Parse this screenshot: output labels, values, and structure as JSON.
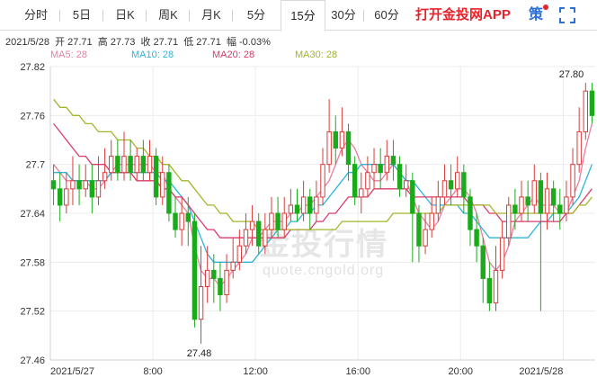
{
  "tabs": [
    {
      "id": "timeshare",
      "label": "分时"
    },
    {
      "id": "5day",
      "label": "5日"
    },
    {
      "id": "daily",
      "label": "日K"
    },
    {
      "id": "weekly",
      "label": "周K"
    },
    {
      "id": "monthly",
      "label": "月K"
    },
    {
      "id": "5min",
      "label": "5分"
    },
    {
      "id": "15min",
      "label": "15分"
    },
    {
      "id": "30min",
      "label": "30分"
    },
    {
      "id": "60min",
      "label": "60分"
    }
  ],
  "active_tab": "15min",
  "promo_text": "打开金投网APP",
  "strategy_label": "策",
  "more_label": "",
  "info_bar": {
    "date": "2021/5/28",
    "open_label": "开",
    "open": "27.71",
    "high_label": "高",
    "high": "27.73",
    "close_label": "收",
    "close": "27.71",
    "low_label": "低",
    "low": "27.71",
    "amp_label": "幅",
    "amp": "-0.03%"
  },
  "legend": [
    {
      "label": "MA5: 28",
      "color": "#e87fa0"
    },
    {
      "label": "MA10: 28",
      "color": "#2bb5d8"
    },
    {
      "label": "MA20: 28",
      "color": "#d93b6a"
    },
    {
      "label": "MA30: 28",
      "color": "#a3b52a"
    }
  ],
  "watermark": {
    "main": "金投行情",
    "sub": "quote.cngold.org"
  },
  "chart_data": {
    "type": "candlestick",
    "interval": "15分",
    "ylim": [
      27.46,
      27.82
    ],
    "y_ticks": [
      "27.82",
      "27.76",
      "27.7",
      "27.64",
      "27.58",
      "27.52",
      "27.46"
    ],
    "y_tick_values": [
      27.82,
      27.76,
      27.7,
      27.64,
      27.58,
      27.52,
      27.46
    ],
    "x_ticks": [
      "2021/5/27",
      "8:00",
      "12:00",
      "16:00",
      "20:00",
      "2021/5/28"
    ],
    "x_tick_index": [
      0,
      16,
      32,
      48,
      64,
      80
    ],
    "annotations": [
      {
        "label": "27.80",
        "index": 83,
        "value": 27.8
      },
      {
        "label": "27.48",
        "index": 23,
        "value": 27.48
      }
    ],
    "up_color": "#d93b3b",
    "down_color": "#1aab1a",
    "candles": [
      [
        27.68,
        27.67,
        27.7,
        27.65
      ],
      [
        27.67,
        27.65,
        27.69,
        27.63
      ],
      [
        27.65,
        27.67,
        27.69,
        27.64
      ],
      [
        27.67,
        27.68,
        27.71,
        27.65
      ],
      [
        27.68,
        27.67,
        27.7,
        27.65
      ],
      [
        27.67,
        27.68,
        27.7,
        27.66
      ],
      [
        27.68,
        27.66,
        27.7,
        27.64
      ],
      [
        27.66,
        27.68,
        27.71,
        27.65
      ],
      [
        27.68,
        27.69,
        27.72,
        27.67
      ],
      [
        27.69,
        27.71,
        27.73,
        27.68
      ],
      [
        27.71,
        27.69,
        27.73,
        27.68
      ],
      [
        27.69,
        27.71,
        27.74,
        27.68
      ],
      [
        27.71,
        27.69,
        27.73,
        27.68
      ],
      [
        27.69,
        27.71,
        27.72,
        27.68
      ],
      [
        27.71,
        27.69,
        27.73,
        27.68
      ],
      [
        27.69,
        27.71,
        27.73,
        27.68
      ],
      [
        27.71,
        27.66,
        27.72,
        27.65
      ],
      [
        27.66,
        27.69,
        27.71,
        27.65
      ],
      [
        27.69,
        27.64,
        27.7,
        27.63
      ],
      [
        27.64,
        27.62,
        27.66,
        27.61
      ],
      [
        27.62,
        27.64,
        27.66,
        27.6
      ],
      [
        27.64,
        27.63,
        27.66,
        27.6
      ],
      [
        27.63,
        27.51,
        27.64,
        27.5
      ],
      [
        27.51,
        27.55,
        27.6,
        27.48
      ],
      [
        27.55,
        27.57,
        27.6,
        27.53
      ],
      [
        27.57,
        27.56,
        27.59,
        27.53
      ],
      [
        27.56,
        27.54,
        27.58,
        27.52
      ],
      [
        27.54,
        27.57,
        27.59,
        27.53
      ],
      [
        27.57,
        27.58,
        27.61,
        27.56
      ],
      [
        27.58,
        27.6,
        27.62,
        27.57
      ],
      [
        27.6,
        27.62,
        27.64,
        27.59
      ],
      [
        27.62,
        27.63,
        27.65,
        27.6
      ],
      [
        27.63,
        27.6,
        27.64,
        27.59
      ],
      [
        27.6,
        27.62,
        27.64,
        27.59
      ],
      [
        27.62,
        27.64,
        27.66,
        27.61
      ],
      [
        27.64,
        27.62,
        27.66,
        27.61
      ],
      [
        27.62,
        27.64,
        27.66,
        27.61
      ],
      [
        27.64,
        27.65,
        27.67,
        27.63
      ],
      [
        27.65,
        27.64,
        27.67,
        27.63
      ],
      [
        27.64,
        27.66,
        27.68,
        27.63
      ],
      [
        27.66,
        27.64,
        27.67,
        27.62
      ],
      [
        27.64,
        27.66,
        27.68,
        27.63
      ],
      [
        27.66,
        27.7,
        27.72,
        27.65
      ],
      [
        27.7,
        27.74,
        27.78,
        27.69
      ],
      [
        27.74,
        27.72,
        27.76,
        27.7
      ],
      [
        27.72,
        27.74,
        27.77,
        27.71
      ],
      [
        27.74,
        27.7,
        27.75,
        27.68
      ],
      [
        27.7,
        27.66,
        27.71,
        27.65
      ],
      [
        27.66,
        27.67,
        27.69,
        27.64
      ],
      [
        27.67,
        27.69,
        27.71,
        27.66
      ],
      [
        27.69,
        27.7,
        27.72,
        27.67
      ],
      [
        27.7,
        27.69,
        27.72,
        27.67
      ],
      [
        27.69,
        27.71,
        27.73,
        27.68
      ],
      [
        27.71,
        27.7,
        27.73,
        27.68
      ],
      [
        27.7,
        27.67,
        27.71,
        27.66
      ],
      [
        27.67,
        27.68,
        27.7,
        27.66
      ],
      [
        27.68,
        27.64,
        27.69,
        27.58
      ],
      [
        27.64,
        27.6,
        27.65,
        27.58
      ],
      [
        27.6,
        27.62,
        27.64,
        27.59
      ],
      [
        27.62,
        27.64,
        27.66,
        27.61
      ],
      [
        27.64,
        27.66,
        27.68,
        27.63
      ],
      [
        27.66,
        27.68,
        27.7,
        27.65
      ],
      [
        27.68,
        27.67,
        27.7,
        27.65
      ],
      [
        27.67,
        27.69,
        27.71,
        27.66
      ],
      [
        27.69,
        27.66,
        27.7,
        27.64
      ],
      [
        27.66,
        27.62,
        27.67,
        27.6
      ],
      [
        27.62,
        27.6,
        27.64,
        27.58
      ],
      [
        27.6,
        27.56,
        27.61,
        27.53
      ],
      [
        27.56,
        27.53,
        27.58,
        27.52
      ],
      [
        27.53,
        27.57,
        27.6,
        27.52
      ],
      [
        27.57,
        27.61,
        27.63,
        27.56
      ],
      [
        27.61,
        27.65,
        27.66,
        27.6
      ],
      [
        27.65,
        27.64,
        27.67,
        27.62
      ],
      [
        27.64,
        27.66,
        27.68,
        27.63
      ],
      [
        27.66,
        27.65,
        27.68,
        27.63
      ],
      [
        27.65,
        27.68,
        27.7,
        27.64
      ],
      [
        27.68,
        27.64,
        27.69,
        27.52
      ],
      [
        27.64,
        27.67,
        27.69,
        27.62
      ],
      [
        27.67,
        27.65,
        27.68,
        27.63
      ],
      [
        27.65,
        27.64,
        27.67,
        27.62
      ],
      [
        27.64,
        27.66,
        27.68,
        27.63
      ],
      [
        27.66,
        27.7,
        27.72,
        27.65
      ],
      [
        27.7,
        27.74,
        27.77,
        27.69
      ],
      [
        27.74,
        27.79,
        27.8,
        27.73
      ],
      [
        27.79,
        27.76,
        27.8,
        27.75
      ]
    ],
    "ma_series": [
      {
        "name": "MA5",
        "color": "#e87fa0",
        "values": [
          27.7,
          27.69,
          27.68,
          27.68,
          27.68,
          27.68,
          27.67,
          27.67,
          27.68,
          27.69,
          27.7,
          27.7,
          27.7,
          27.7,
          27.7,
          27.7,
          27.69,
          27.69,
          27.67,
          27.66,
          27.65,
          27.64,
          27.6,
          27.57,
          27.56,
          27.56,
          27.55,
          27.56,
          27.57,
          27.58,
          27.59,
          27.61,
          27.61,
          27.62,
          27.63,
          27.63,
          27.63,
          27.64,
          27.64,
          27.65,
          27.65,
          27.66,
          27.67,
          27.68,
          27.7,
          27.72,
          27.73,
          27.72,
          27.7,
          27.69,
          27.68,
          27.68,
          27.69,
          27.7,
          27.69,
          27.68,
          27.66,
          27.64,
          27.63,
          27.62,
          27.63,
          27.65,
          27.66,
          27.67,
          27.67,
          27.66,
          27.64,
          27.61,
          27.58,
          27.57,
          27.58,
          27.6,
          27.63,
          27.64,
          27.65,
          27.66,
          27.65,
          27.65,
          27.65,
          27.64,
          27.64,
          27.66,
          27.68,
          27.72,
          27.75
        ]
      },
      {
        "name": "MA10",
        "color": "#2bb5d8",
        "values": [
          27.69,
          27.69,
          27.69,
          27.68,
          27.68,
          27.68,
          27.68,
          27.68,
          27.68,
          27.69,
          27.69,
          27.69,
          27.69,
          27.69,
          27.69,
          27.69,
          27.69,
          27.68,
          27.68,
          27.67,
          27.66,
          27.65,
          27.63,
          27.61,
          27.59,
          27.58,
          27.58,
          27.58,
          27.58,
          27.58,
          27.58,
          27.58,
          27.59,
          27.6,
          27.61,
          27.62,
          27.62,
          27.63,
          27.63,
          27.64,
          27.64,
          27.65,
          27.65,
          27.66,
          27.67,
          27.68,
          27.69,
          27.69,
          27.7,
          27.7,
          27.7,
          27.7,
          27.7,
          27.7,
          27.69,
          27.68,
          27.68,
          27.67,
          27.66,
          27.65,
          27.65,
          27.65,
          27.65,
          27.65,
          27.64,
          27.64,
          27.63,
          27.62,
          27.61,
          27.61,
          27.61,
          27.61,
          27.61,
          27.61,
          27.61,
          27.62,
          27.63,
          27.63,
          27.64,
          27.64,
          27.64,
          27.65,
          27.66,
          27.68,
          27.7
        ]
      },
      {
        "name": "MA20",
        "color": "#d93b6a",
        "values": [
          27.75,
          27.74,
          27.73,
          27.72,
          27.71,
          27.71,
          27.7,
          27.7,
          27.7,
          27.69,
          27.69,
          27.69,
          27.69,
          27.68,
          27.68,
          27.68,
          27.68,
          27.67,
          27.67,
          27.66,
          27.66,
          27.65,
          27.64,
          27.63,
          27.62,
          27.62,
          27.61,
          27.61,
          27.61,
          27.61,
          27.61,
          27.61,
          27.61,
          27.61,
          27.61,
          27.61,
          27.61,
          27.62,
          27.62,
          27.62,
          27.62,
          27.63,
          27.63,
          27.64,
          27.64,
          27.65,
          27.66,
          27.66,
          27.66,
          27.66,
          27.67,
          27.67,
          27.67,
          27.67,
          27.67,
          27.67,
          27.66,
          27.66,
          27.66,
          27.66,
          27.66,
          27.66,
          27.66,
          27.66,
          27.66,
          27.65,
          27.65,
          27.65,
          27.64,
          27.64,
          27.63,
          27.63,
          27.63,
          27.63,
          27.63,
          27.63,
          27.63,
          27.63,
          27.63,
          27.63,
          27.64,
          27.64,
          27.65,
          27.66,
          27.67
        ]
      },
      {
        "name": "MA30",
        "color": "#a3b52a",
        "values": [
          27.78,
          27.77,
          27.77,
          27.76,
          27.76,
          27.75,
          27.75,
          27.74,
          27.74,
          27.74,
          27.73,
          27.73,
          27.73,
          27.72,
          27.72,
          27.71,
          27.71,
          27.7,
          27.7,
          27.69,
          27.68,
          27.68,
          27.67,
          27.66,
          27.65,
          27.65,
          27.64,
          27.64,
          27.63,
          27.63,
          27.63,
          27.63,
          27.62,
          27.62,
          27.62,
          27.62,
          27.62,
          27.62,
          27.62,
          27.62,
          27.62,
          27.62,
          27.62,
          27.62,
          27.62,
          27.63,
          27.63,
          27.63,
          27.63,
          27.63,
          27.63,
          27.63,
          27.63,
          27.64,
          27.64,
          27.64,
          27.64,
          27.64,
          27.64,
          27.64,
          27.64,
          27.65,
          27.65,
          27.65,
          27.65,
          27.65,
          27.65,
          27.65,
          27.65,
          27.64,
          27.64,
          27.64,
          27.64,
          27.64,
          27.64,
          27.64,
          27.64,
          27.64,
          27.64,
          27.64,
          27.64,
          27.64,
          27.65,
          27.65,
          27.66
        ]
      }
    ]
  }
}
